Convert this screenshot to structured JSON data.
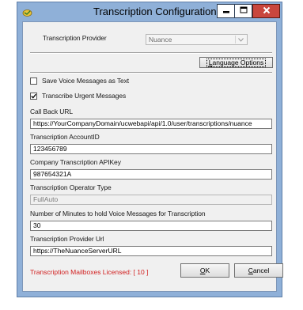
{
  "window": {
    "title": "Transcription Configuration"
  },
  "provider": {
    "label": "Transcription Provider",
    "selected": "Nuance"
  },
  "buttons": {
    "language_options": "Language Options",
    "language_options_mnemonic": "L",
    "language_options_rest": "anguage Options",
    "ok": "OK",
    "ok_mnemonic": "O",
    "ok_rest": "K",
    "cancel": "Cancel",
    "cancel_mnemonic": "C",
    "cancel_rest": "ancel"
  },
  "options": {
    "save_voice_messages_as_text": {
      "label": "Save Voice Messages as Text",
      "checked": false
    },
    "transcribe_urgent_messages": {
      "label": "Transcribe Urgent Messages",
      "checked": true
    }
  },
  "fields": {
    "call_back_url": {
      "label": "Call Back URL",
      "value": "https://YourCompanyDomain/ucwebapi/api/1.0/user/transcriptions/nuance"
    },
    "account_id": {
      "label": "Transcription AccountID",
      "value": "123456789"
    },
    "api_key": {
      "label": "Company Transcription APIKey",
      "value": "987654321A"
    },
    "operator_type": {
      "label": "Transcription Operator Type",
      "value": "FullAuto"
    },
    "minutes_to_hold": {
      "label": "Number of Minutes to hold Voice Messages for Transcription",
      "value": "30"
    },
    "provider_url": {
      "label": "Transcription Provider Url",
      "value": "https://TheNuanceServerURL"
    }
  },
  "status": {
    "licensed_text": "Transcription Mailboxes Licensed: [ 10 ]"
  },
  "colors": {
    "title_bar": "#8fb0d8",
    "close_button": "#c9463d",
    "dialog_background": "#f0f0f0",
    "license_text": "#d11e1e"
  },
  "icons": {
    "app": "app-icon",
    "minimize": "minimize-icon",
    "maximize": "maximize-icon",
    "close": "close-icon",
    "dropdown": "chevron-down-icon",
    "checkmark": "checkmark-icon"
  }
}
